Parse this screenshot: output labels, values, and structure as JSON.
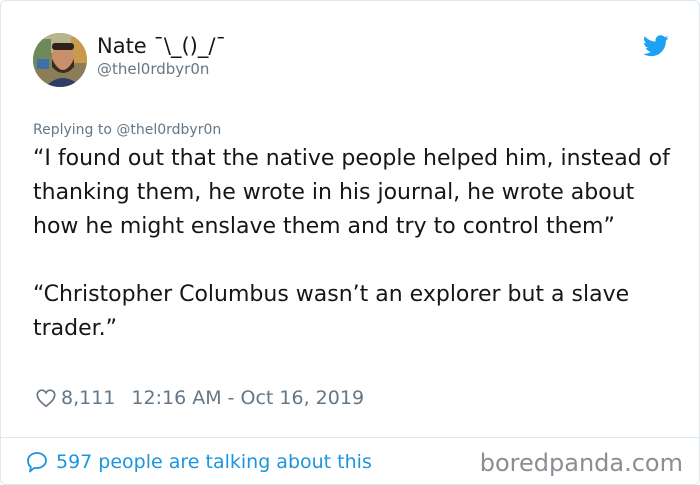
{
  "user": {
    "display_name": "Nate ¯\\_()_/¯",
    "handle": "@thel0rdbyr0n"
  },
  "replying_to": "Replying to @thel0rdbyr0n",
  "tweet": {
    "paragraph_1": "“I found out that the native people helped him, instead of thanking them, he wrote in his journal, he wrote about how he might enslave them and try to control them”",
    "paragraph_2": "“Christopher Columbus wasn’t an explorer but a slave trader.”"
  },
  "meta": {
    "likes": "8,111",
    "timestamp": "12:16 AM - Oct 16, 2019"
  },
  "footer": {
    "conversation_text": "597 people are talking about this"
  },
  "watermark": "boredpanda.com",
  "icons": {
    "brand": "twitter-bird-icon",
    "like": "heart-icon",
    "conversation": "speech-bubble-icon"
  },
  "colors": {
    "twitter_blue": "#1da1f2",
    "link_blue": "#1b95e0",
    "secondary_text": "#657786",
    "primary_text": "#14171a",
    "border": "#e1e8ed"
  }
}
